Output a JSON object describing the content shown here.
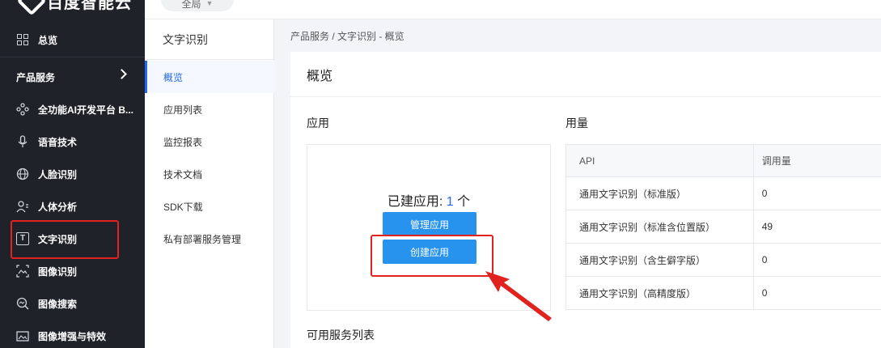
{
  "brand": {
    "name": "百度智能云"
  },
  "region": {
    "label": "全局"
  },
  "nav": {
    "overview": "总览",
    "product_section": "产品服务",
    "items": [
      {
        "label": "全功能AI开发平台 B...",
        "icon": "dots-cluster-icon"
      },
      {
        "label": "语音技术",
        "icon": "microphone-icon"
      },
      {
        "label": "人脸识别",
        "icon": "globe-icon"
      },
      {
        "label": "人体分析",
        "icon": "person-icon"
      },
      {
        "label": "文字识别",
        "icon": "text-box-icon",
        "icon_char": "T"
      },
      {
        "label": "图像识别",
        "icon": "image-scan-icon"
      },
      {
        "label": "图像搜索",
        "icon": "image-search-icon"
      },
      {
        "label": "图像增强与特效",
        "icon": "image-enhance-icon"
      }
    ]
  },
  "subnav": {
    "title": "文字识别",
    "items": [
      {
        "label": "概览"
      },
      {
        "label": "应用列表"
      },
      {
        "label": "监控报表"
      },
      {
        "label": "技术文档"
      },
      {
        "label": "SDK下载"
      },
      {
        "label": "私有部署服务管理"
      }
    ]
  },
  "breadcrumb": {
    "text": "产品服务 / 文字识别 - 概览"
  },
  "main": {
    "title": "概览",
    "apps_label": "应用",
    "usage_label": "用量",
    "created_prefix": "已建应用: ",
    "created_count": "1",
    "created_suffix": " 个",
    "manage_button": "管理应用",
    "create_button": "创建应用",
    "services_label": "可用服务列表"
  },
  "usage_table": {
    "headers": [
      "API",
      "调用量"
    ],
    "rows": [
      [
        "通用文字识别（标准版）",
        "0"
      ],
      [
        "通用文字识别（标准含位置版）",
        "49"
      ],
      [
        "通用文字识别（含生僻字版）",
        "0"
      ],
      [
        "通用文字识别（高精度版）",
        "0"
      ]
    ]
  },
  "colors": {
    "accent": "#2468f2",
    "button": "#2893ee",
    "highlight": "#e0231f",
    "nav_bg": "#1f2229"
  }
}
